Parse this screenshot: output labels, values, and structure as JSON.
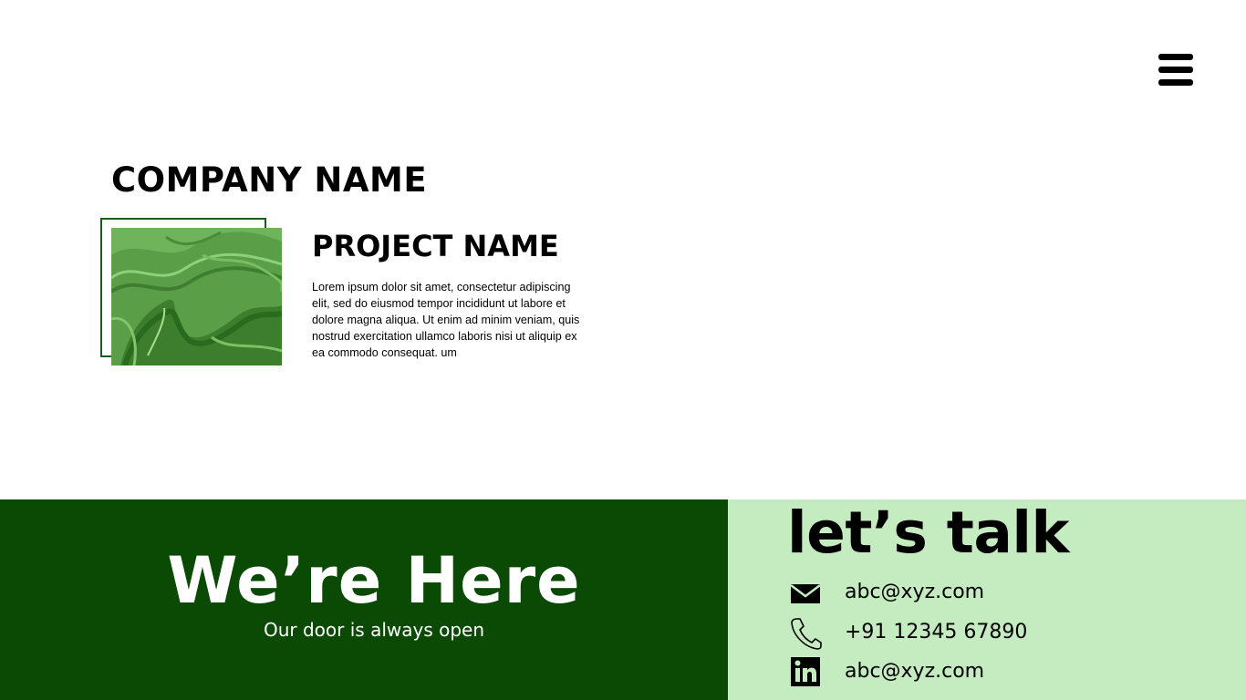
{
  "header": {
    "menu_icon": "hamburger-menu-icon"
  },
  "company": {
    "name": "COMPANY NAME"
  },
  "project": {
    "image": "green-marble-image",
    "name": "PROJECT NAME",
    "description": "Lorem ipsum dolor sit amet, consectetur adipiscing elit, sed do eiusmod tempor incididunt ut labore et dolore magna aliqua. Ut enim ad minim veniam, quis nostrud exercitation ullamco laboris nisi ut aliquip ex ea commodo consequat. um"
  },
  "footer": {
    "heading": "We’re Here",
    "subheading": "Our door is always open",
    "contact_heading": "let’s talk",
    "contacts": [
      {
        "icon": "envelope-icon",
        "text": "abc@xyz.com"
      },
      {
        "icon": "phone-icon",
        "text": "+91 12345 67890"
      },
      {
        "icon": "linkedin-icon",
        "text": "abc@xyz.com"
      }
    ]
  },
  "colors": {
    "dark_green": "#0b4a04",
    "light_green": "#c5ebc1",
    "frame_green": "#1c5a1c",
    "text": "#000000",
    "white": "#ffffff"
  }
}
